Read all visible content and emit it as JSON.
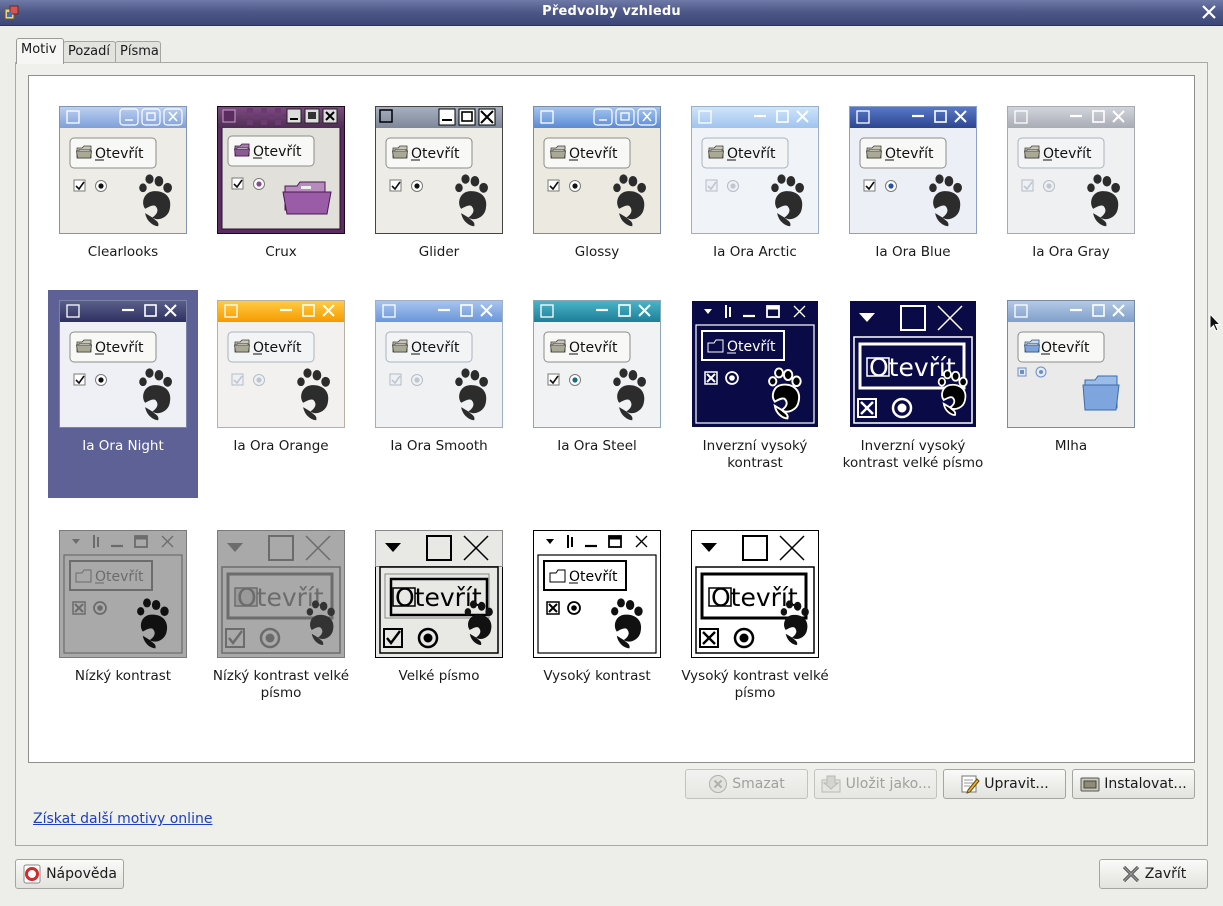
{
  "window": {
    "title": "Předvolby vzhledu"
  },
  "tabs": [
    "Motiv",
    "Pozadí",
    "Písma"
  ],
  "themes": [
    {
      "name": "Clearlooks",
      "style": "clearlooks",
      "selected": false
    },
    {
      "name": "Crux",
      "style": "crux",
      "selected": false
    },
    {
      "name": "Glider",
      "style": "glider",
      "selected": false
    },
    {
      "name": "Glossy",
      "style": "glossy",
      "selected": false
    },
    {
      "name": "Ia Ora Arctic",
      "style": "arctic",
      "selected": false
    },
    {
      "name": "Ia Ora Blue",
      "style": "iablue",
      "selected": false
    },
    {
      "name": "Ia Ora Gray",
      "style": "iagray",
      "selected": false
    },
    {
      "name": "Ia Ora Night",
      "style": "night",
      "selected": true
    },
    {
      "name": "Ia Ora Orange",
      "style": "orange",
      "selected": false
    },
    {
      "name": "Ia Ora Smooth",
      "style": "smooth",
      "selected": false
    },
    {
      "name": "Ia Ora Steel",
      "style": "steel",
      "selected": false
    },
    {
      "name": "Inverzní vysoký kontrast",
      "style": "inverse",
      "selected": false
    },
    {
      "name": "Inverzní vysoký kontrast velké písmo",
      "style": "inverse-large",
      "selected": false
    },
    {
      "name": "Mlha",
      "style": "mist",
      "selected": false
    },
    {
      "name": "Nízký kontrast",
      "style": "lowcontrast",
      "selected": false
    },
    {
      "name": "Nízký kontrast velké písmo",
      "style": "lowcontrast-large",
      "selected": false
    },
    {
      "name": "Velké písmo",
      "style": "largeprint",
      "selected": false
    },
    {
      "name": "Vysoký kontrast",
      "style": "highcontrast",
      "selected": false
    },
    {
      "name": "Vysoký kontrast velké písmo",
      "style": "highcontrast-large",
      "selected": false
    }
  ],
  "preview_button_label": "Otevřít",
  "actions": {
    "delete": "Smazat",
    "save_as": "Uložit jako...",
    "edit": "Upravit...",
    "install": "Instalovat..."
  },
  "online_link": "Získat další motivy online",
  "help_button": "Nápověda",
  "close_button": "Zavřít",
  "colors": {
    "selection": "#5e6196",
    "titlebar": "#4e5888",
    "link": "#1e3fbf"
  }
}
